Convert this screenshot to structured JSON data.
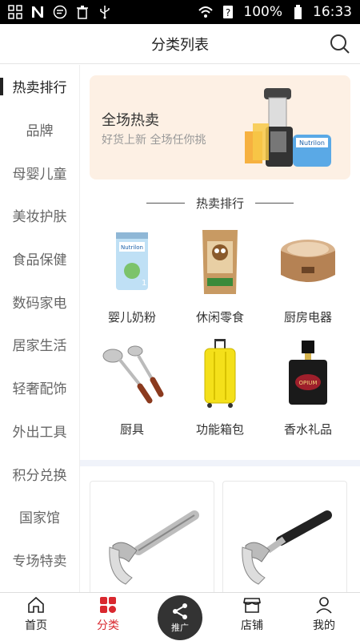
{
  "status": {
    "battery": "100%",
    "time": "16:33"
  },
  "header": {
    "title": "分类列表"
  },
  "sidebar": {
    "items": [
      {
        "label": "热卖排行",
        "active": true
      },
      {
        "label": "品牌"
      },
      {
        "label": "母婴儿童"
      },
      {
        "label": "美妆护肤"
      },
      {
        "label": "食品保健"
      },
      {
        "label": "数码家电"
      },
      {
        "label": "居家生活"
      },
      {
        "label": "轻奢配饰"
      },
      {
        "label": "外出工具"
      },
      {
        "label": "积分兑换"
      },
      {
        "label": "国家馆"
      },
      {
        "label": "专场特卖"
      }
    ]
  },
  "banner": {
    "title": "全场热卖",
    "subtitle": "好货上新 全场任你挑"
  },
  "section": {
    "title": "热卖排行"
  },
  "categories": [
    {
      "label": "婴儿奶粉"
    },
    {
      "label": "休闲零食"
    },
    {
      "label": "厨房电器"
    },
    {
      "label": "厨具"
    },
    {
      "label": "功能箱包"
    },
    {
      "label": "香水礼品"
    }
  ],
  "tabbar": {
    "items": [
      {
        "label": "首页"
      },
      {
        "label": "分类",
        "active": true
      },
      {
        "label": "推广"
      },
      {
        "label": "店铺"
      },
      {
        "label": "我的"
      }
    ]
  },
  "colors": {
    "accent": "#d9282f",
    "banner_bg": "#fdf0e4",
    "divider": "#f0f3fa"
  }
}
